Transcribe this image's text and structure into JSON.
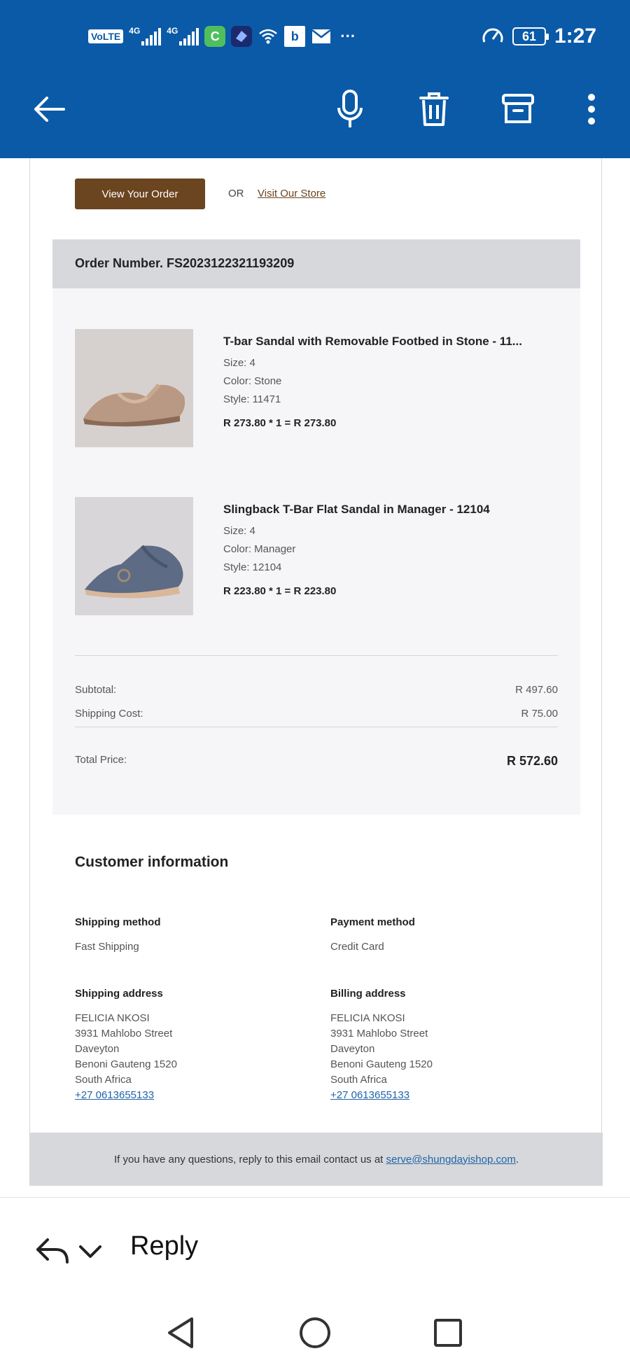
{
  "status_bar": {
    "volte": "VoLTE",
    "sim1": "4G",
    "sim2": "4G",
    "battery": "61",
    "time": "1:27",
    "icons": [
      "signal-icon",
      "wifi-icon",
      "cast-icon",
      "bing-icon",
      "mail-icon",
      "more-icon",
      "speed-icon"
    ]
  },
  "toolbar": {
    "icons": [
      "back-arrow-icon",
      "microphone-icon",
      "delete-icon",
      "archive-icon",
      "overflow-menu-icon"
    ]
  },
  "email": {
    "view_order_label": "View Your Order",
    "or_label": "OR",
    "visit_store_label": "Visit Our Store",
    "order_number": "Order Number. FS2023122321193209",
    "items": [
      {
        "title": "T-bar Sandal with Removable Footbed in Stone - 11...",
        "size": "Size: 4",
        "color": "Color: Stone",
        "style": "Style: 11471",
        "price": "R 273.80 * 1 = R 273.80"
      },
      {
        "title": "Slingback T-Bar Flat Sandal in Manager - 12104",
        "size": "Size: 4",
        "color": "Color: Manager",
        "style": "Style: 12104",
        "price": "R 223.80 * 1 = R 223.80"
      }
    ],
    "summary": {
      "subtotal_label": "Subtotal:",
      "subtotal_value": "R 497.60",
      "shipping_label": "Shipping Cost:",
      "shipping_value": "R 75.00",
      "total_label": "Total Price:",
      "total_value": "R 572.60"
    },
    "customer": {
      "title": "Customer information",
      "shipping_method_label": "Shipping method",
      "shipping_method": "Fast Shipping",
      "payment_method_label": "Payment method",
      "payment_method": "Credit Card",
      "shipping_address_label": "Shipping address",
      "billing_address_label": "Billing address",
      "shipping_address": {
        "name": "FELICIA NKOSI",
        "street": "3931 Mahlobo Street",
        "suburb": "Daveyton",
        "city": "Benoni Gauteng 1520",
        "country": "South Africa",
        "phone": "+27 0613655133"
      },
      "billing_address": {
        "name": "FELICIA NKOSI",
        "street": "3931 Mahlobo Street",
        "suburb": "Daveyton",
        "city": "Benoni Gauteng 1520",
        "country": "South Africa",
        "phone": "+27 0613655133"
      }
    },
    "footer": {
      "text": "If you have any questions, reply to this email contact us at ",
      "email": "serve@shungdayishop.com",
      "end": "."
    }
  },
  "reply_bar": {
    "label": "Reply"
  },
  "nav_bar": {
    "icons": [
      "nav-back-icon",
      "nav-home-icon",
      "nav-recents-icon"
    ]
  },
  "colors": {
    "app_bar": "#0a5aa8",
    "order_button": "#6b4420",
    "link": "#2064a8",
    "panel": "#f6f6f8",
    "header_band": "#d6d8db"
  }
}
